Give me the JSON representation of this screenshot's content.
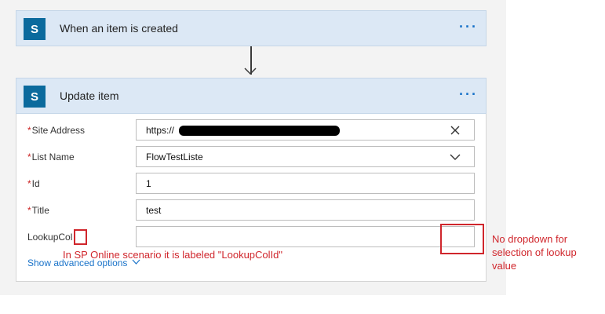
{
  "trigger": {
    "title": "When an item is created",
    "more": "···"
  },
  "action": {
    "title": "Update item",
    "more": "···"
  },
  "fields": {
    "site_address": {
      "label": "Site Address",
      "required": "*",
      "value": "https://"
    },
    "list_name": {
      "label": "List Name",
      "required": "*",
      "value": "FlowTestListe"
    },
    "id": {
      "label": "Id",
      "required": "*",
      "value": "1"
    },
    "title": {
      "label": "Title",
      "required": "*",
      "value": "test"
    },
    "lookupcol": {
      "label": "LookupCol",
      "value": ""
    }
  },
  "advanced": {
    "label": "Show advanced options"
  },
  "annotations": {
    "label_note": "In SP Online scenario it is labeled \"LookupColId\"",
    "dropdown_note": "No dropdown for selection of lookup value"
  },
  "colors": {
    "accent": "#1a73c9",
    "header_bg": "#dce8f5",
    "sp_icon": "#0b6a9d",
    "annotation": "#d0262c"
  },
  "icons": {
    "connector": "sharepoint-icon",
    "more": "more-icon",
    "clear": "clear-icon",
    "dropdown": "chevron-down-icon"
  }
}
